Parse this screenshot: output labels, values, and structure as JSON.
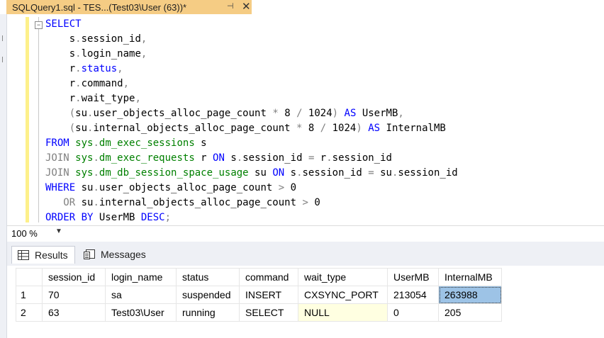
{
  "tab": {
    "title": "SQLQuery1.sql - TES...(Test03\\User (63))*",
    "pin_icon": "pin-icon",
    "close_icon": "close-icon"
  },
  "code": [
    [
      {
        "t": "SELECT",
        "c": "kw"
      }
    ],
    [
      {
        "t": "    s",
        "c": ""
      },
      {
        "t": ".",
        "c": "gray"
      },
      {
        "t": "session_id",
        "c": ""
      },
      {
        "t": ",",
        "c": "gray"
      }
    ],
    [
      {
        "t": "    s",
        "c": ""
      },
      {
        "t": ".",
        "c": "gray"
      },
      {
        "t": "login_name",
        "c": ""
      },
      {
        "t": ",",
        "c": "gray"
      }
    ],
    [
      {
        "t": "    r",
        "c": ""
      },
      {
        "t": ".",
        "c": "gray"
      },
      {
        "t": "status",
        "c": "kw"
      },
      {
        "t": ",",
        "c": "gray"
      }
    ],
    [
      {
        "t": "    r",
        "c": ""
      },
      {
        "t": ".",
        "c": "gray"
      },
      {
        "t": "command",
        "c": ""
      },
      {
        "t": ",",
        "c": "gray"
      }
    ],
    [
      {
        "t": "    r",
        "c": ""
      },
      {
        "t": ".",
        "c": "gray"
      },
      {
        "t": "wait_type",
        "c": ""
      },
      {
        "t": ",",
        "c": "gray"
      }
    ],
    [
      {
        "t": "    (",
        "c": "gray"
      },
      {
        "t": "su",
        "c": ""
      },
      {
        "t": ".",
        "c": "gray"
      },
      {
        "t": "user_objects_alloc_page_count ",
        "c": ""
      },
      {
        "t": "*",
        "c": "gray"
      },
      {
        "t": " 8 ",
        "c": ""
      },
      {
        "t": "/",
        "c": "gray"
      },
      {
        "t": " 1024",
        "c": ""
      },
      {
        "t": ")",
        "c": "gray"
      },
      {
        "t": " AS ",
        "c": "kw"
      },
      {
        "t": "UserMB",
        "c": ""
      },
      {
        "t": ",",
        "c": "gray"
      }
    ],
    [
      {
        "t": "    (",
        "c": "gray"
      },
      {
        "t": "su",
        "c": ""
      },
      {
        "t": ".",
        "c": "gray"
      },
      {
        "t": "internal_objects_alloc_page_count ",
        "c": ""
      },
      {
        "t": "*",
        "c": "gray"
      },
      {
        "t": " 8 ",
        "c": ""
      },
      {
        "t": "/",
        "c": "gray"
      },
      {
        "t": " 1024",
        "c": ""
      },
      {
        "t": ")",
        "c": "gray"
      },
      {
        "t": " AS ",
        "c": "kw"
      },
      {
        "t": "InternalMB",
        "c": ""
      }
    ],
    [
      {
        "t": "FROM ",
        "c": "kw"
      },
      {
        "t": "sys",
        "c": "sys"
      },
      {
        "t": ".",
        "c": "gray"
      },
      {
        "t": "dm_exec_sessions",
        "c": "sys"
      },
      {
        "t": " s",
        "c": ""
      }
    ],
    [
      {
        "t": "JOIN ",
        "c": "gray"
      },
      {
        "t": "sys",
        "c": "sys"
      },
      {
        "t": ".",
        "c": "gray"
      },
      {
        "t": "dm_exec_requests",
        "c": "sys"
      },
      {
        "t": " r ",
        "c": ""
      },
      {
        "t": "ON ",
        "c": "kw"
      },
      {
        "t": "s",
        "c": ""
      },
      {
        "t": ".",
        "c": "gray"
      },
      {
        "t": "session_id ",
        "c": ""
      },
      {
        "t": "=",
        "c": "gray"
      },
      {
        "t": " r",
        "c": ""
      },
      {
        "t": ".",
        "c": "gray"
      },
      {
        "t": "session_id",
        "c": ""
      }
    ],
    [
      {
        "t": "JOIN ",
        "c": "gray"
      },
      {
        "t": "sys",
        "c": "sys"
      },
      {
        "t": ".",
        "c": "gray"
      },
      {
        "t": "dm_db_session_space_usage",
        "c": "sys"
      },
      {
        "t": " su ",
        "c": ""
      },
      {
        "t": "ON ",
        "c": "kw"
      },
      {
        "t": "s",
        "c": ""
      },
      {
        "t": ".",
        "c": "gray"
      },
      {
        "t": "session_id ",
        "c": ""
      },
      {
        "t": "=",
        "c": "gray"
      },
      {
        "t": " su",
        "c": ""
      },
      {
        "t": ".",
        "c": "gray"
      },
      {
        "t": "session_id",
        "c": ""
      }
    ],
    [
      {
        "t": "WHERE ",
        "c": "kw"
      },
      {
        "t": "su",
        "c": ""
      },
      {
        "t": ".",
        "c": "gray"
      },
      {
        "t": "user_objects_alloc_page_count ",
        "c": ""
      },
      {
        "t": ">",
        "c": "gray"
      },
      {
        "t": " 0",
        "c": ""
      }
    ],
    [
      {
        "t": "   OR ",
        "c": "gray"
      },
      {
        "t": "su",
        "c": ""
      },
      {
        "t": ".",
        "c": "gray"
      },
      {
        "t": "internal_objects_alloc_page_count ",
        "c": ""
      },
      {
        "t": ">",
        "c": "gray"
      },
      {
        "t": " 0",
        "c": ""
      }
    ],
    [
      {
        "t": "ORDER BY ",
        "c": "kw"
      },
      {
        "t": "UserMB ",
        "c": ""
      },
      {
        "t": "DESC",
        "c": "kw"
      },
      {
        "t": ";",
        "c": "gray"
      }
    ]
  ],
  "zoom": {
    "value": "100 %"
  },
  "results_tabs": [
    {
      "label": "Results",
      "icon": "grid-icon",
      "active": true
    },
    {
      "label": "Messages",
      "icon": "messages-icon",
      "active": false
    }
  ],
  "grid": {
    "columns": [
      "",
      "session_id",
      "login_name",
      "status",
      "command",
      "wait_type",
      "UserMB",
      "InternalMB"
    ],
    "rows": [
      [
        "1",
        "70",
        "sa",
        "suspended",
        "INSERT",
        "CXSYNC_PORT",
        "213054",
        "263988"
      ],
      [
        "2",
        "63",
        "Test03\\User",
        "running",
        "SELECT",
        "NULL",
        "0",
        "205"
      ]
    ]
  }
}
